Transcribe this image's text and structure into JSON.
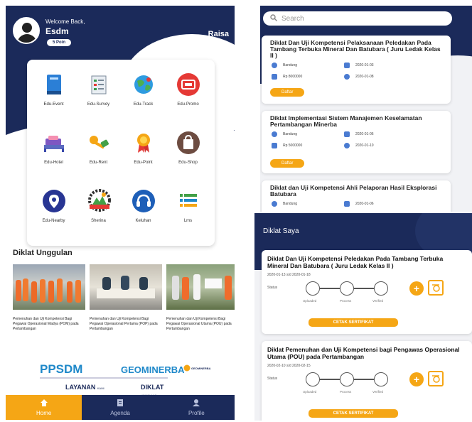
{
  "home": {
    "welcome": "Welcome Back,",
    "username": "Esdm",
    "points": "5 Poin",
    "right_name": "Raisa",
    "menu": [
      {
        "label": "Edu-Event",
        "icon": "book-icon"
      },
      {
        "label": "Edu-Survey",
        "icon": "survey-icon"
      },
      {
        "label": "Edu-Track",
        "icon": "globe-icon"
      },
      {
        "label": "Edu-Promo",
        "icon": "promo-icon"
      },
      {
        "label": "Edu-Hotel",
        "icon": "hotel-icon"
      },
      {
        "label": "Edu-Rent",
        "icon": "key-icon"
      },
      {
        "label": "Edu-Point",
        "icon": "medal-icon"
      },
      {
        "label": "Edu-Shop",
        "icon": "shopping-bag-icon"
      },
      {
        "label": "Edu-Nearby",
        "icon": "location-pin-icon"
      },
      {
        "label": "Sherina",
        "icon": "sherina-logo-icon"
      },
      {
        "label": "Keluhan",
        "icon": "headset-icon"
      },
      {
        "label": "Lms",
        "icon": "list-icon"
      }
    ],
    "section_title": "Diklat Unggulan",
    "courses": [
      {
        "title": "Pemenuhan dan Uji Kompetensi Bagi Pegawai Operasional Madya (POM) pada Pertambangan"
      },
      {
        "title": "Pemenuhan dan Uji Kompetensi Bagi Pegawai Operasional Pertama (POP) pada Pertambangan"
      },
      {
        "title": "Pemenuhan dan Uji Kompetensi Bagi Pegawai Operasional Utama (POU) pada Pertambangan"
      }
    ],
    "banner": {
      "main": "PPSDM",
      "sub": "GEOMINERBA",
      "left": "LAYANAN",
      "right": "DIKLAT",
      "left_small": "KAMI",
      "right_small": "UNGGULAN",
      "logo_text": "GEOMINERBA"
    },
    "nav": [
      {
        "label": "Home",
        "icon": "home-icon"
      },
      {
        "label": "Agenda",
        "icon": "agenda-icon"
      },
      {
        "label": "Profile",
        "icon": "profile-icon"
      }
    ]
  },
  "events": {
    "search_placeholder": "Search",
    "items": [
      {
        "title": "Diklat Dan Uji Kompetensi Pelaksanaan Peledakan Pada Tambang Terbuka Mineral Dan Batubara ( Juru Ledak Kelas II )",
        "location": "Bandung",
        "price": "Rp 8000000",
        "start": "2020-01-03",
        "end": "2020-01-08",
        "button": "Daftar"
      },
      {
        "title": "Diklat Implementasi Sistem Manajemen Keselamatan Pertambangan Minerba",
        "location": "Bandung",
        "price": "Rp 5000000",
        "start": "2020-01-06",
        "end": "2020-01-10",
        "button": "Daftar"
      },
      {
        "title": "Diklat dan Uji Kompetensi Ahli Pelaporan Hasil Eksplorasi Batubara",
        "location": "Bandung",
        "start": "2020-01-06"
      }
    ]
  },
  "my_courses": {
    "title": "Diklat Saya",
    "status_label": "Status",
    "steps": [
      "Uploaded",
      "Process",
      "Verified"
    ],
    "items": [
      {
        "title": "Diklat Dan Uji Kompetensi Peledakan Pada Tambang Terbuka Mineral Dan Batubara ( Juru Ledak Kelas II )",
        "dates": "2020-01-13 s/d 2020-01-18",
        "button": "CETAK SERTIFIKAT"
      },
      {
        "title": "Diklat Pemenuhan dan Uji Kompetensi bagi Pengawas Operasional Utama (POU) pada Pertambangan",
        "dates": "2020-02-10 s/d 2020-02-15",
        "button": "CETAK SERTIFIKAT"
      }
    ]
  },
  "colors": {
    "navy": "#1b2a5a",
    "accent": "#f5a615",
    "link": "#1e88c9"
  }
}
